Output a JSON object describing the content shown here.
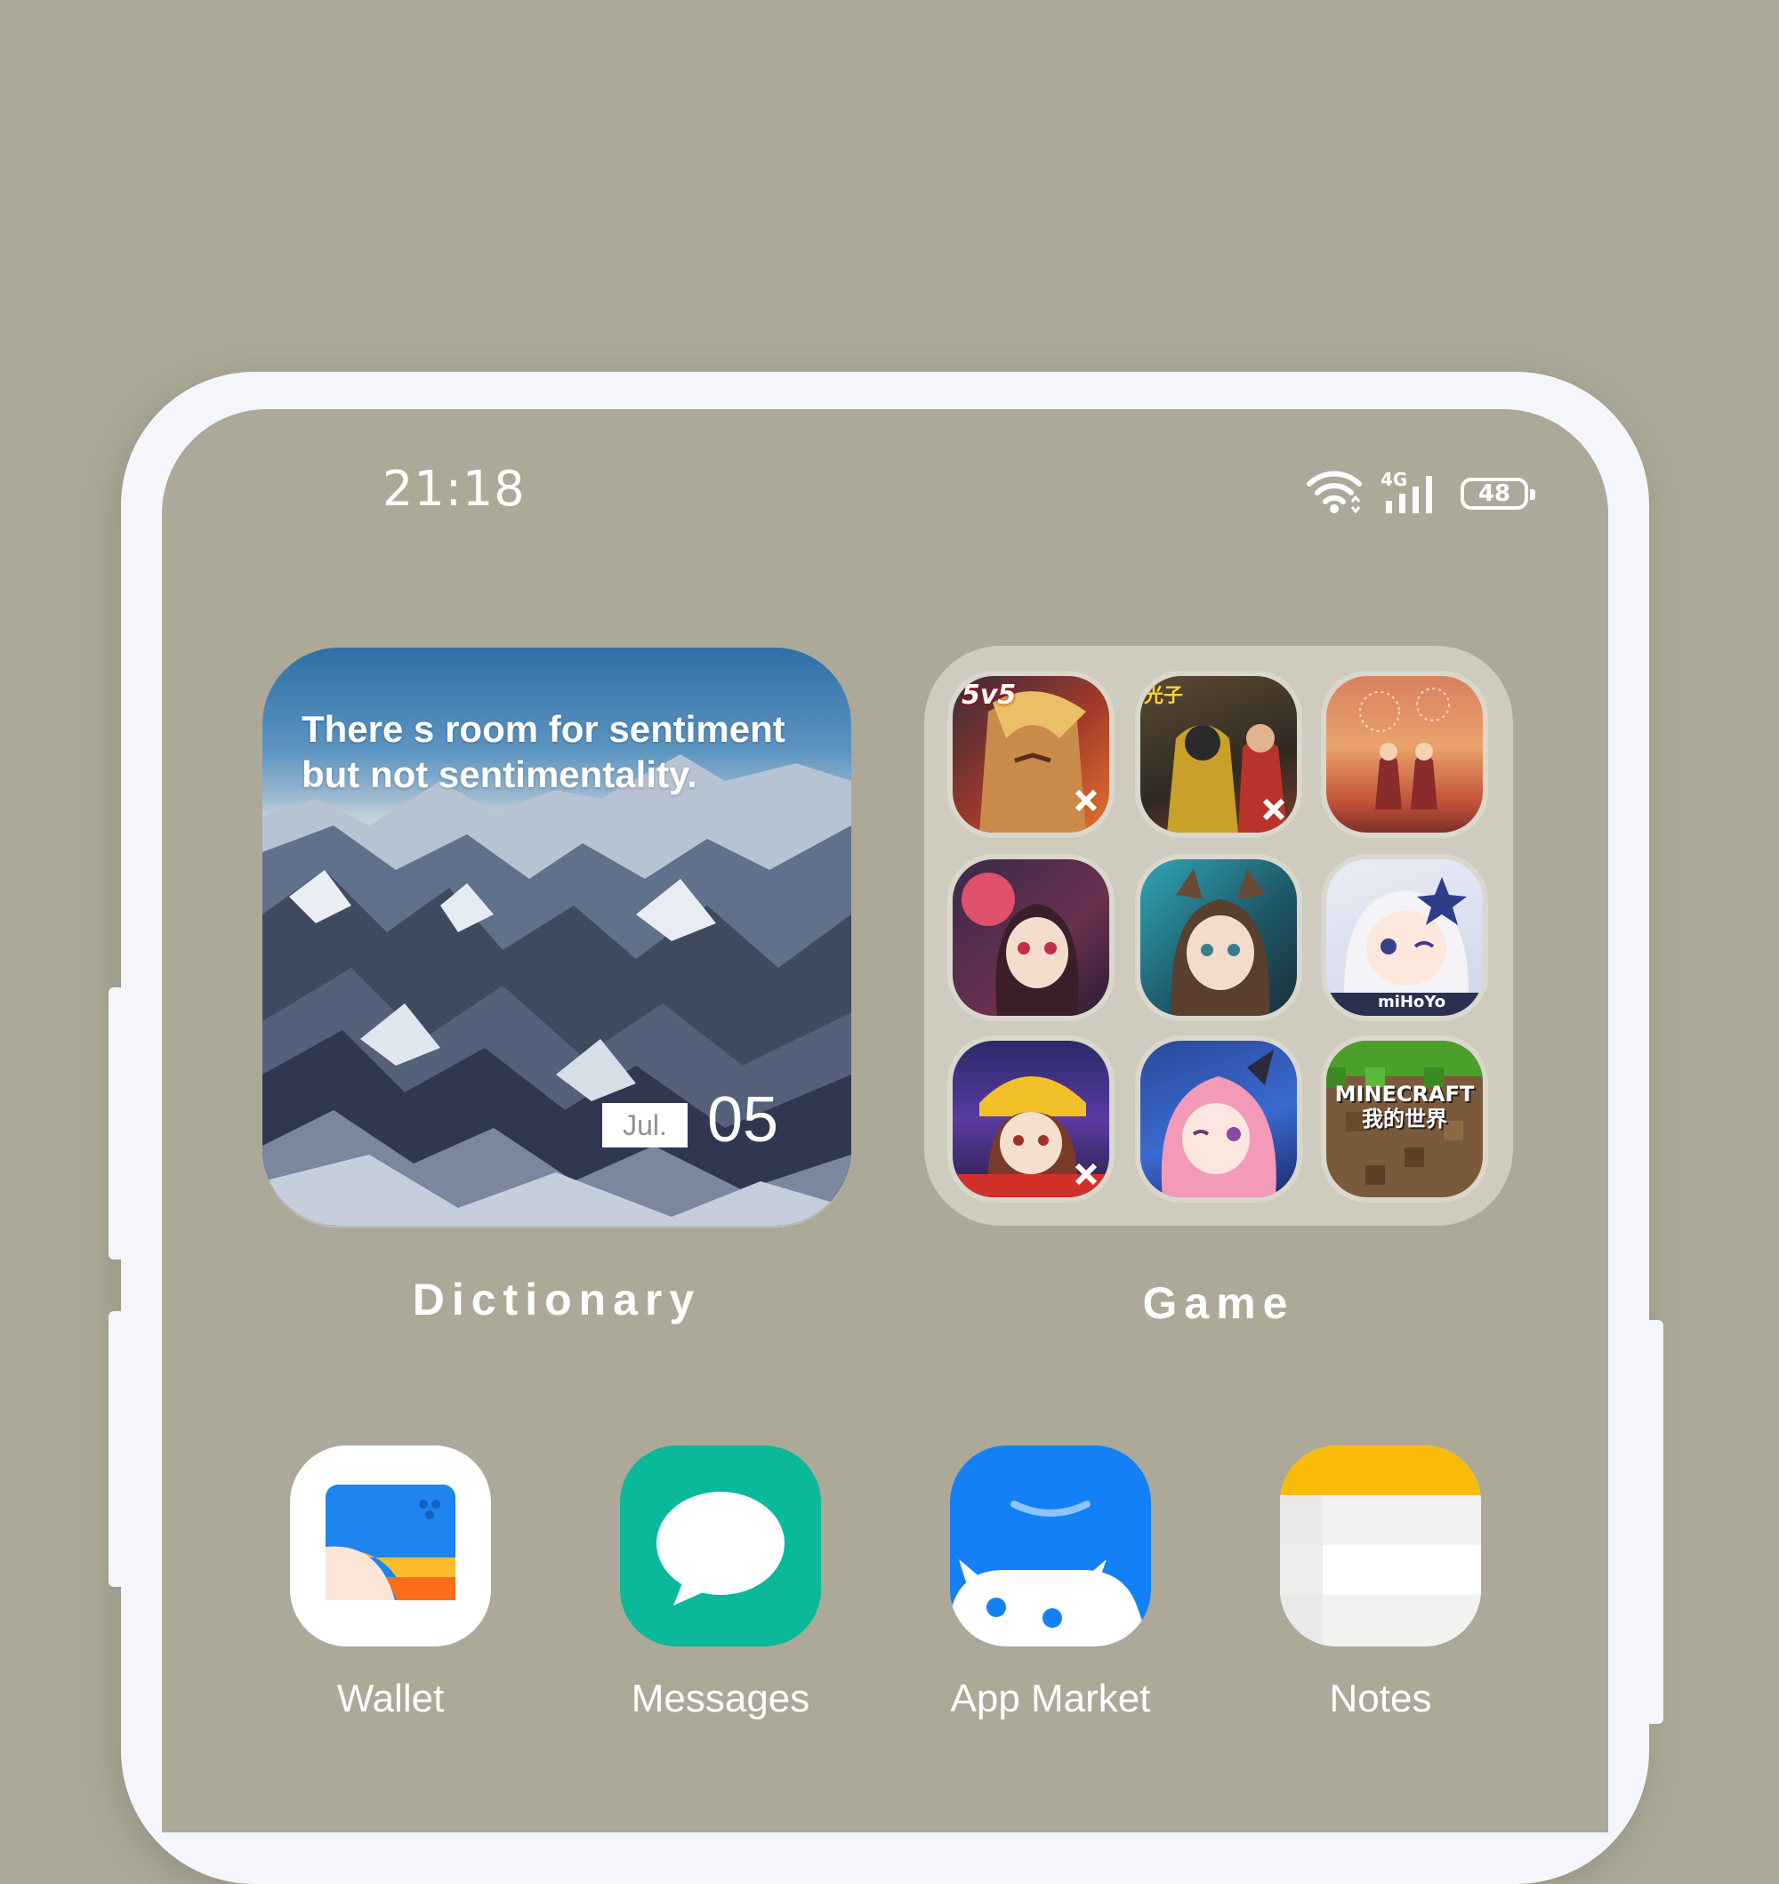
{
  "status_bar": {
    "time": "21:18",
    "network": "4G",
    "battery": "48"
  },
  "dictionary_widget": {
    "quote": "There  s room for sentiment but not sentimentality.",
    "month": "Jul.",
    "day": "05",
    "label": "Dictionary"
  },
  "game_folder": {
    "label": "Game",
    "apps": [
      {
        "name": "5v5 battle game",
        "icon": "game-hero-icon",
        "badge": "5v5"
      },
      {
        "name": "Battle royale game",
        "icon": "game-soldier-icon",
        "badge": "光子"
      },
      {
        "name": "Sky couple game",
        "icon": "game-sunset-icon"
      },
      {
        "name": "Anime girl game",
        "icon": "game-anime-girl-icon"
      },
      {
        "name": "Arknights",
        "icon": "game-arknights-icon"
      },
      {
        "name": "Genshin",
        "icon": "game-paimon-icon",
        "badge": "miHoYo"
      },
      {
        "name": "Racing anime game",
        "icon": "game-racer-icon"
      },
      {
        "name": "Pink hair anime game",
        "icon": "game-pink-girl-icon"
      },
      {
        "name": "Minecraft",
        "icon": "game-minecraft-icon",
        "badge": "MINECRAFT 我的世界"
      }
    ]
  },
  "dock": [
    {
      "label": "Wallet",
      "icon": "wallet-icon"
    },
    {
      "label": "Messages",
      "icon": "messages-icon"
    },
    {
      "label": "App Market",
      "icon": "app-market-icon"
    },
    {
      "label": "Notes",
      "icon": "notes-icon"
    }
  ],
  "colors": {
    "wallpaper": "#aca998",
    "frame": "#f4f6fb",
    "messages": "#0ab89a",
    "app_market": "#1480f5",
    "notes_yellow": "#fbbb09"
  }
}
